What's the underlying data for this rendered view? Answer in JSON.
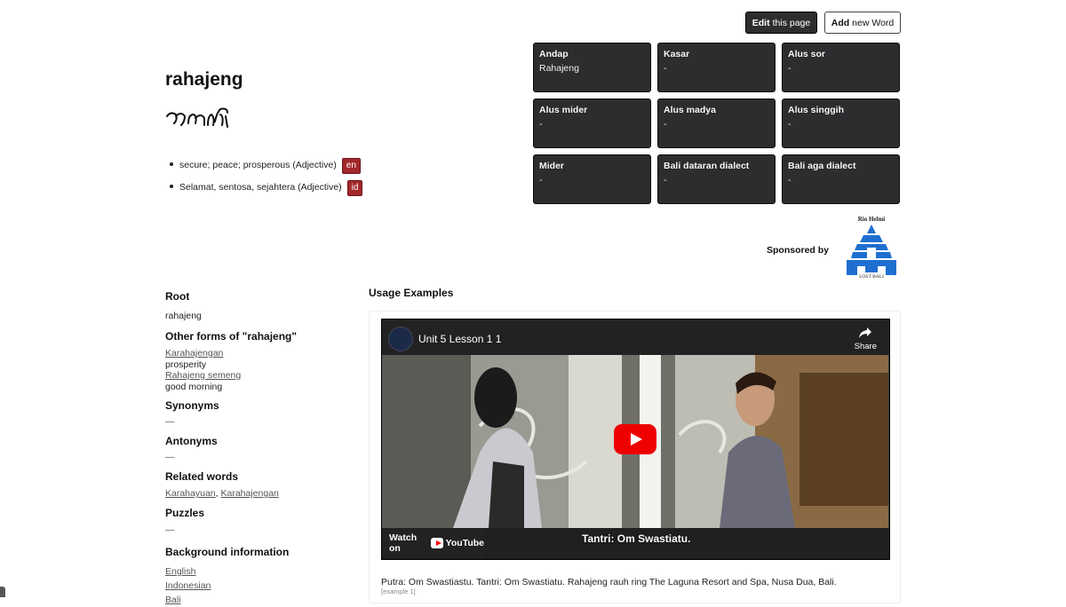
{
  "toolbar": {
    "edit_strong": "Edit",
    "edit_rest": "this page",
    "add_strong": "Add",
    "add_rest": "new Word"
  },
  "word": {
    "title": "rahajeng",
    "definitions": [
      {
        "text": "secure; peace; prosperous (Adjective)",
        "lang": "en"
      },
      {
        "text": "Selamat, sentosa, sejahtera (Adjective)",
        "lang": "id"
      }
    ]
  },
  "registers": [
    {
      "name": "Andap",
      "value": "Rahajeng"
    },
    {
      "name": "Kasar",
      "value": "-"
    },
    {
      "name": "Alus sor",
      "value": "-"
    },
    {
      "name": "Alus mider",
      "value": "-"
    },
    {
      "name": "Alus madya",
      "value": "-"
    },
    {
      "name": "Alus singgih",
      "value": "-"
    },
    {
      "name": "Mider",
      "value": "-"
    },
    {
      "name": "Bali dataran dialect",
      "value": "-"
    },
    {
      "name": "Bali aga dialect",
      "value": "-"
    }
  ],
  "sponsor": {
    "label": "Sponsored by",
    "logo_top": "Rio Helmi",
    "logo_bottom": "LOST BALI"
  },
  "sidebar": {
    "root_title": "Root",
    "root_value": "rahajeng",
    "other_title": "Other forms of \"rahajeng\"",
    "other_forms": [
      {
        "word": "Karahajengan",
        "meaning": "prosperity"
      },
      {
        "word": "Rahajeng semeng",
        "meaning": "good morning"
      }
    ],
    "synonyms_title": "Synonyms",
    "synonyms_value": "—",
    "antonyms_title": "Antonyms",
    "antonyms_value": "—",
    "related_title": "Related words",
    "related": [
      "Karahayuan",
      "Karahajengan"
    ],
    "related_sep": ", ",
    "puzzles_title": "Puzzles",
    "puzzles_value": "—",
    "background_title": "Background information",
    "background_links": [
      "English",
      "Indonesian",
      "Bali"
    ]
  },
  "usage": {
    "title": "Usage Examples",
    "video": {
      "title": "Unit 5 Lesson 1 1",
      "share": "Share",
      "watch_on": "Watch on",
      "youtube": "YouTube",
      "subtitle": "Tantri: Om Swastiatu."
    },
    "example_text": "Putra: Om Swastiastu. Tantri: Om Swastiatu. Rahajeng rauh ring The Laguna Resort and Spa, Nusa Dua, Bali.",
    "example_ref": "[example 1]"
  }
}
